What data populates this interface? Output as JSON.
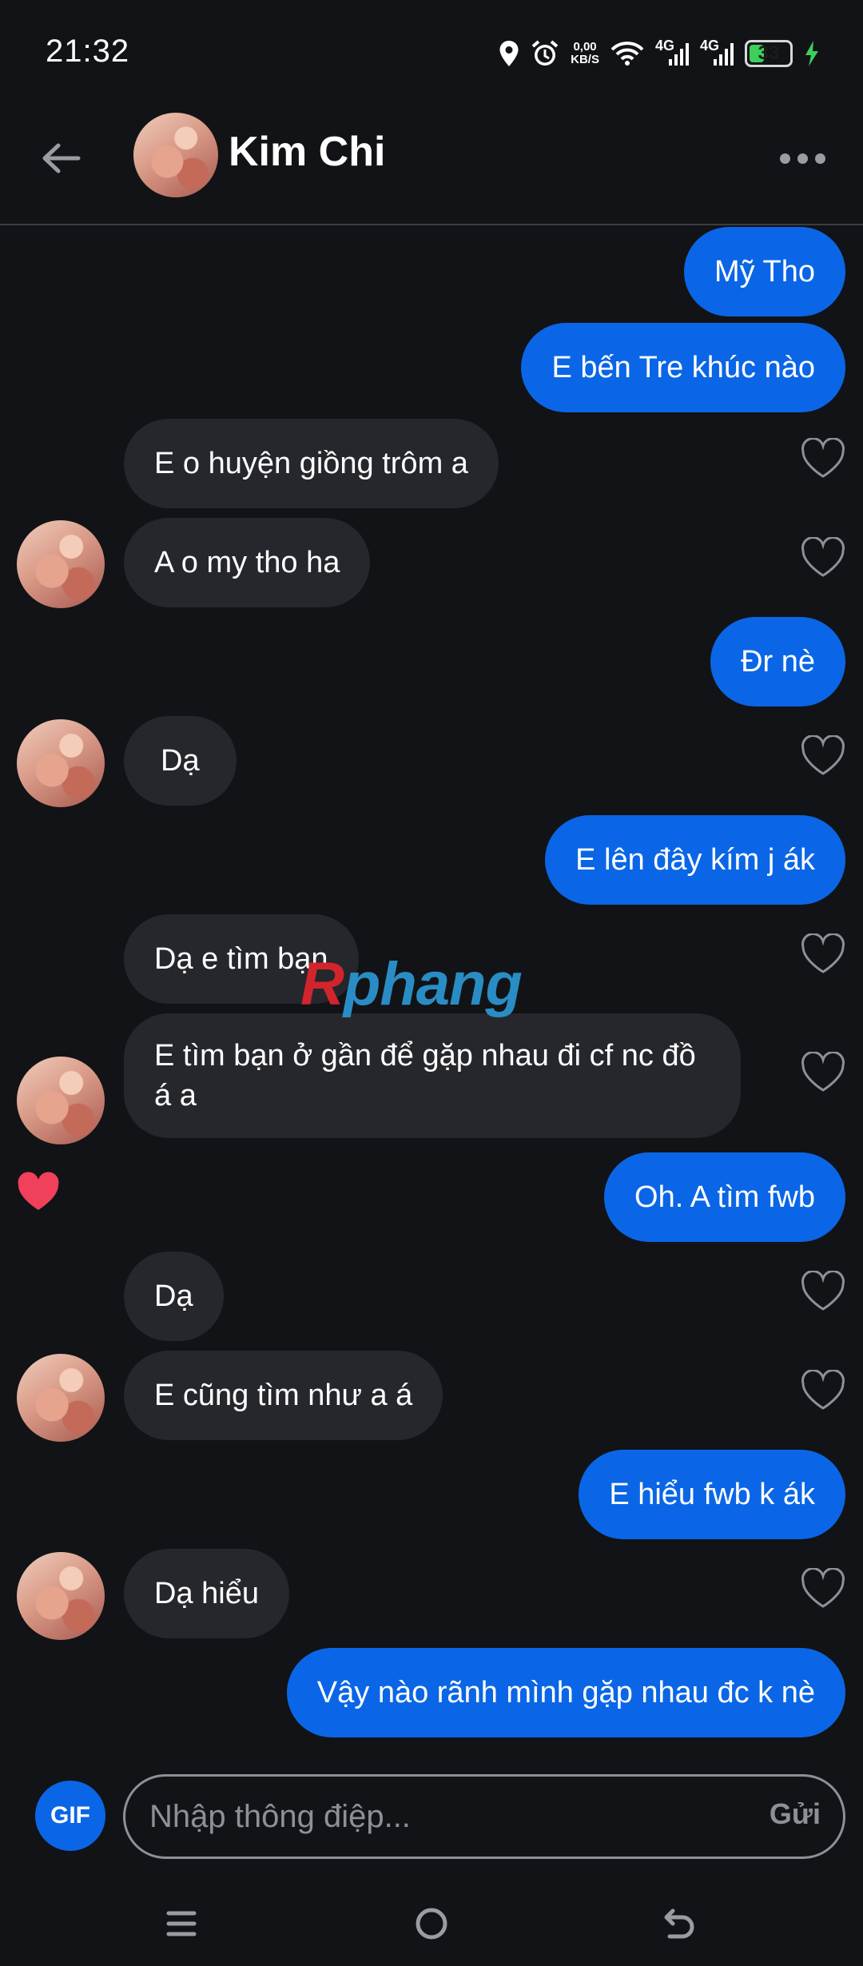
{
  "status_bar": {
    "time": "21:32",
    "net_speed_value": "0,00",
    "net_speed_unit": "KB/S",
    "network_1": "4G",
    "network_2": "4G",
    "battery": "33"
  },
  "header": {
    "name": "Kim Chi"
  },
  "messages": [
    {
      "side": "sent",
      "text": "Mỹ Tho"
    },
    {
      "side": "sent",
      "text": "E bến Tre khúc nào"
    },
    {
      "side": "recv",
      "text": "E o huyện giồng trôm a"
    },
    {
      "side": "recv",
      "text": "A o my tho ha"
    },
    {
      "side": "sent",
      "text": "Đr nè"
    },
    {
      "side": "recv",
      "text": "Dạ"
    },
    {
      "side": "sent",
      "text": "E lên đây kím j ák"
    },
    {
      "side": "recv",
      "text": "Dạ e tìm bạn"
    },
    {
      "side": "recv",
      "text": "E tìm bạn ở gần để gặp nhau đi cf nc đồ á a"
    },
    {
      "side": "sent",
      "text": "Oh. A tìm fwb"
    },
    {
      "side": "recv",
      "text": "Dạ"
    },
    {
      "side": "recv",
      "text": "E cũng tìm như a á"
    },
    {
      "side": "sent",
      "text": "E hiểu fwb k ák"
    },
    {
      "side": "recv",
      "text": "Dạ hiểu"
    },
    {
      "side": "sent",
      "text": "Vậy nào rãnh mình gặp nhau đc k nè"
    }
  ],
  "composer": {
    "gif_label": "GIF",
    "placeholder": "Nhập thông điệp...",
    "send_label": "Gửi"
  },
  "watermark": {
    "part1": "R",
    "part2": "phang"
  },
  "colors": {
    "sent_bubble": "#0a66e6",
    "recv_bubble": "#26272c",
    "background": "#121316",
    "heart_active": "#f0405a"
  }
}
